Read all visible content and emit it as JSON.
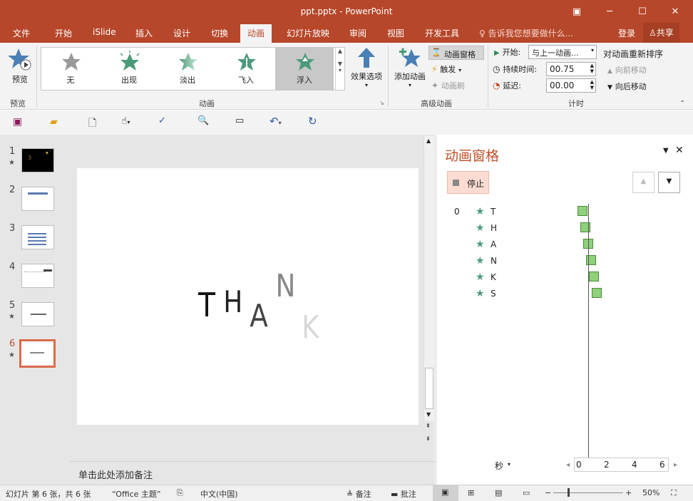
{
  "window": {
    "title": "ppt.pptx - PowerPoint"
  },
  "tabs": [
    "文件",
    "开始",
    "iSlide",
    "插入",
    "设计",
    "切换",
    "动画",
    "幻灯片放映",
    "审阅",
    "视图",
    "开发工具"
  ],
  "active_tab": "动画",
  "tell_me": "告诉我您想要做什么...",
  "login": "登录",
  "share": "共享",
  "ribbon": {
    "preview": {
      "label": "预览",
      "group": "预览"
    },
    "gallery": {
      "items": [
        "无",
        "出现",
        "淡出",
        "飞入",
        "浮入"
      ],
      "selected": "浮入",
      "group": "动画"
    },
    "effect_options": "效果选项",
    "add_animation": "添加动画",
    "anim_pane": "动画窗格",
    "trigger": "触发",
    "anim_painter": "动画刷",
    "advanced_group": "高级动画",
    "start_label": "开始:",
    "start_value": "与上一动画...",
    "duration_label": "持续时间:",
    "duration_value": "00.75",
    "delay_label": "延迟:",
    "delay_value": "00.00",
    "timing_group": "计时",
    "reorder_title": "对动画重新排序",
    "move_earlier": "向前移动",
    "move_later": "向后移动"
  },
  "thumbnails": [
    {
      "num": "1",
      "star": "★"
    },
    {
      "num": "2",
      "star": ""
    },
    {
      "num": "3",
      "star": ""
    },
    {
      "num": "4",
      "star": ""
    },
    {
      "num": "5",
      "star": "★"
    },
    {
      "num": "6",
      "star": "★"
    }
  ],
  "slide": {
    "letters": [
      "T",
      "H",
      "A",
      "N",
      "K"
    ]
  },
  "notes_placeholder": "单击此处添加备注",
  "anim_panel": {
    "title": "动画窗格",
    "stop": "停止",
    "index": "0",
    "items": [
      {
        "name": "T",
        "start": 0.0
      },
      {
        "name": "H",
        "start": 0.1
      },
      {
        "name": "A",
        "start": 0.2
      },
      {
        "name": "N",
        "start": 0.3
      },
      {
        "name": "K",
        "start": 0.4
      },
      {
        "name": "S",
        "start": 0.5
      }
    ],
    "time_unit": "秒",
    "ticks": [
      "0",
      "2",
      "4",
      "6"
    ]
  },
  "status": {
    "slide_info": "幻灯片 第 6 张，共 6 张",
    "theme": "“Office 主题”",
    "language": "中文(中国)",
    "notes": "备注",
    "comments": "批注",
    "zoom": "50%"
  },
  "colors": {
    "accent": "#b7472a",
    "ribbon": "#f3f3f3",
    "pane": "#e6e6e6"
  }
}
